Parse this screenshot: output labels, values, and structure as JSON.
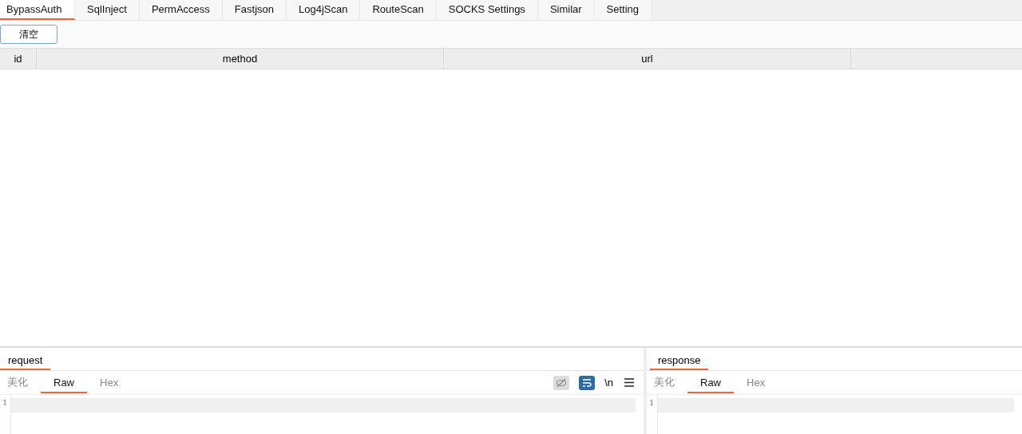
{
  "tabs": [
    {
      "label": "BypassAuth",
      "selected": true
    },
    {
      "label": "SqlInject",
      "selected": false
    },
    {
      "label": "PermAccess",
      "selected": false
    },
    {
      "label": "Fastjson",
      "selected": false
    },
    {
      "label": "Log4jScan",
      "selected": false
    },
    {
      "label": "RouteScan",
      "selected": false
    },
    {
      "label": "SOCKS Settings",
      "selected": false
    },
    {
      "label": "Similar",
      "selected": false
    },
    {
      "label": "Setting",
      "selected": false
    }
  ],
  "toolbar": {
    "buttons": [
      "清空"
    ]
  },
  "table": {
    "columns": [
      "id",
      "method",
      "url"
    ]
  },
  "panes": [
    {
      "title": "request",
      "view_tabs": [
        {
          "label": "美化",
          "selected": false
        },
        {
          "label": "Raw",
          "selected": true
        },
        {
          "label": "Hex",
          "selected": false
        }
      ],
      "tools": [
        {
          "kind": "hide",
          "on": false
        },
        {
          "kind": "wrap",
          "on": true
        },
        {
          "kind": "text",
          "label": "\\n"
        },
        {
          "kind": "menu"
        }
      ],
      "line_numbers": [
        "1"
      ]
    },
    {
      "title": "response",
      "view_tabs": [
        {
          "label": "美化",
          "selected": false
        },
        {
          "label": "Raw",
          "selected": true
        },
        {
          "label": "Hex",
          "selected": false
        }
      ],
      "line_numbers": [
        "1"
      ]
    }
  ]
}
